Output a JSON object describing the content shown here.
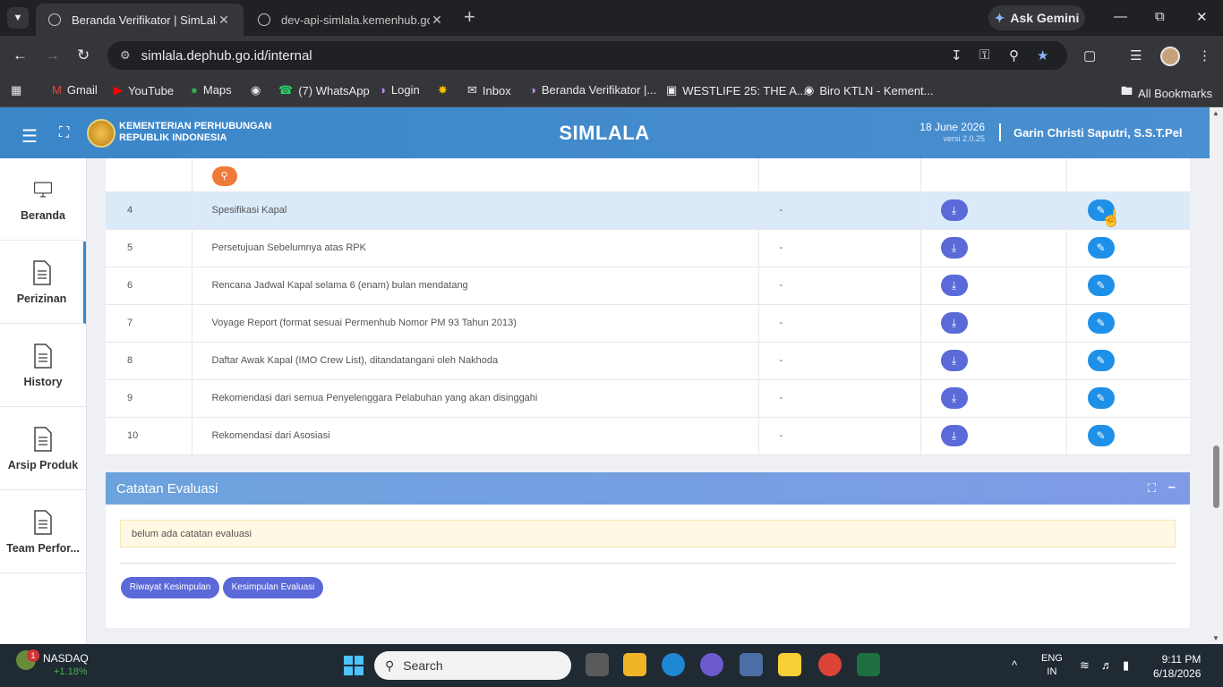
{
  "browser": {
    "tabs": [
      {
        "title": "Beranda Verifikator | SimLala",
        "active": true
      },
      {
        "title": "dev-api-simlala.kemenhub.go.id",
        "active": false
      }
    ],
    "ask_gemini": "Ask Gemini",
    "url": "simlala.dephub.go.id/internal",
    "bookmarks": [
      "Gmail",
      "YouTube",
      "Maps",
      "(7) WhatsApp",
      "Login",
      "Inbox",
      "Beranda Verifikator |...",
      "WESTLIFE 25: THE A...",
      "Biro KTLN - Kement..."
    ],
    "all_bookmarks": "All Bookmarks"
  },
  "header": {
    "org_line1": "KEMENTERIAN PERHUBUNGAN",
    "org_line2": "REPUBLIK INDONESIA",
    "app_title": "SIMLALA",
    "date": "18 June 2026",
    "version": "versi 2.0.25",
    "user": "Garin Christi Saputri, S.S.T.Pel"
  },
  "sidebar": {
    "items": [
      {
        "label": "Beranda"
      },
      {
        "label": "Perizinan"
      },
      {
        "label": "History"
      },
      {
        "label": "Arsip Produk"
      },
      {
        "label": "Team Perfor..."
      }
    ]
  },
  "documents": {
    "rows": [
      {
        "no": "4",
        "name": "Spesifikasi Kapal",
        "status": "-"
      },
      {
        "no": "5",
        "name": "Persetujuan Sebelumnya atas RPK",
        "status": "-"
      },
      {
        "no": "6",
        "name": "Rencana Jadwal Kapal selama 6 (enam) bulan mendatang",
        "status": "-"
      },
      {
        "no": "7",
        "name": "Voyage Report (format sesuai Permenhub Nomor PM 93 Tahun 2013)",
        "status": "-"
      },
      {
        "no": "8",
        "name": "Daftar Awak Kapal (IMO Crew List), ditandatangani oleh Nakhoda",
        "status": "-"
      },
      {
        "no": "9",
        "name": "Rekomendasi dari semua Penyelenggara Pelabuhan yang akan disinggahi",
        "status": "-"
      },
      {
        "no": "10",
        "name": "Rekomendasi dari Asosiasi",
        "status": "-"
      }
    ]
  },
  "evaluasi": {
    "title": "Catatan Evaluasi",
    "note": "belum ada catatan evaluasi",
    "btn_riwayat": "Riwayat Kesimpulan",
    "btn_kesimpulan": "Kesimpulan Evaluasi"
  },
  "taskbar": {
    "stock_badge": "1",
    "stock_name": "NASDAQ",
    "stock_change": "+1.18%",
    "search": "Search",
    "lang1": "ENG",
    "lang2": "IN",
    "time": "9:11 PM",
    "date": "6/18/2026"
  }
}
